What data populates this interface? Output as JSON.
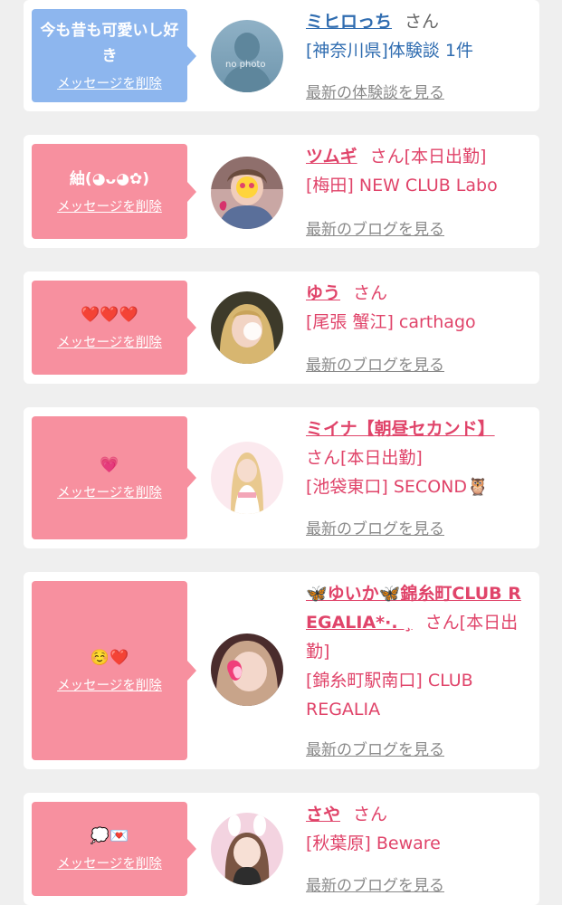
{
  "items": [
    {
      "message": "今も昔も可愛いし好き",
      "delete_label": "メッセージを削除",
      "bubble_color": "#8db6ee",
      "avatar_kind": "no-photo",
      "avatar_text": "no photo",
      "name": "ミヒロっち",
      "san": "さん",
      "status": "",
      "detail": "[神奈川県]体験談 1件",
      "more": "最新の体験談を見る"
    },
    {
      "message": "紬(◕ᴗ◕✿)",
      "delete_label": "メッセージを削除",
      "bubble_color": "#f7909f",
      "avatar_kind": "photo",
      "name": "ツムギ",
      "san": "さん",
      "status": "[本日出勤]",
      "detail": "[梅田] NEW CLUB Labo",
      "more": "最新のブログを見る"
    },
    {
      "message": "❤️❤️❤️",
      "delete_label": "メッセージを削除",
      "bubble_color": "#f7909f",
      "avatar_kind": "photo",
      "name": "ゆう",
      "san": "さん",
      "status": "",
      "detail": "[尾張 蟹江] carthago",
      "more": "最新のブログを見る"
    },
    {
      "message": "💗",
      "delete_label": "メッセージを削除",
      "bubble_color": "#f7909f",
      "avatar_kind": "photo",
      "name": "ミイナ【朝昼セカンド】",
      "san": "さん",
      "status": "[本日出勤]",
      "detail": "[池袋東口] SECOND🦉",
      "more": "最新のブログを見る"
    },
    {
      "message": "☺️❤️",
      "delete_label": "メッセージを削除",
      "bubble_color": "#f7909f",
      "avatar_kind": "photo",
      "name": "🦋ゆいか🦋錦糸町CLUB REGALIA*·. ¸",
      "san": "さん",
      "status": "[本日出勤]",
      "detail": "[錦糸町駅南口] CLUB REGALIA",
      "more": "最新のブログを見る"
    },
    {
      "message": "💭💌",
      "delete_label": "メッセージを削除",
      "bubble_color": "#f7909f",
      "avatar_kind": "photo",
      "name": "さや",
      "san": "さん",
      "status": "",
      "detail": "[秋葉原] Beware",
      "more": "最新のブログを見る"
    }
  ]
}
